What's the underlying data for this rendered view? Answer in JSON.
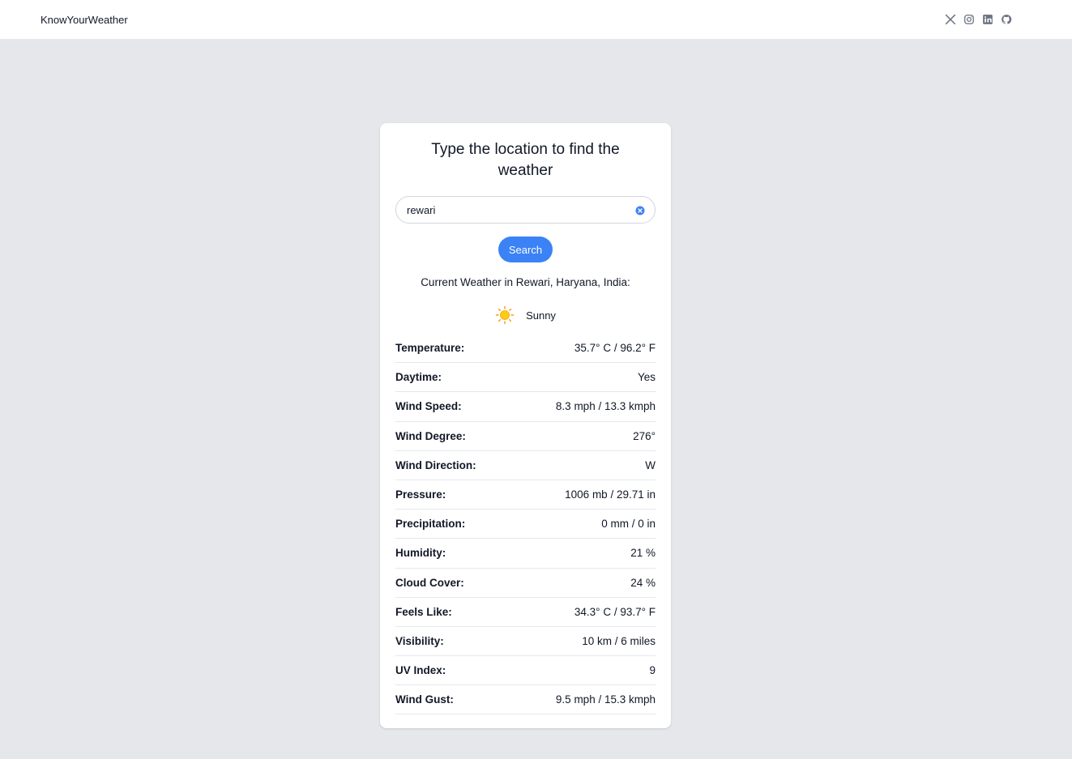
{
  "navbar": {
    "brand": "KnowYourWeather",
    "socials": [
      "x-icon",
      "instagram-icon",
      "linkedin-icon",
      "github-icon"
    ]
  },
  "card": {
    "title": "Type the location to find the weather",
    "search": {
      "value": "rewari",
      "placeholder": ""
    },
    "search_label": "Search",
    "heading": "Current Weather in Rewari, Haryana, India:",
    "condition": {
      "icon": "sun-icon",
      "text": "Sunny"
    },
    "rows": [
      {
        "label": "Temperature:",
        "value": "35.7° C / 96.2° F"
      },
      {
        "label": "Daytime:",
        "value": "Yes"
      },
      {
        "label": "Wind Speed:",
        "value": "8.3 mph / 13.3 kmph"
      },
      {
        "label": "Wind Degree:",
        "value": "276°"
      },
      {
        "label": "Wind Direction:",
        "value": "W"
      },
      {
        "label": "Pressure:",
        "value": "1006 mb / 29.71 in"
      },
      {
        "label": "Precipitation:",
        "value": "0 mm / 0 in"
      },
      {
        "label": "Humidity:",
        "value": "21 %"
      },
      {
        "label": "Cloud Cover:",
        "value": "24 %"
      },
      {
        "label": "Feels Like:",
        "value": "34.3° C / 93.7° F"
      },
      {
        "label": "Visibility:",
        "value": "10 km / 6 miles"
      },
      {
        "label": "UV Index:",
        "value": "9"
      },
      {
        "label": "Wind Gust:",
        "value": "9.5 mph / 15.3 kmph"
      }
    ]
  },
  "colors": {
    "accent": "#3b82f6",
    "background": "#e5e7eb",
    "sun": "#facc15"
  }
}
